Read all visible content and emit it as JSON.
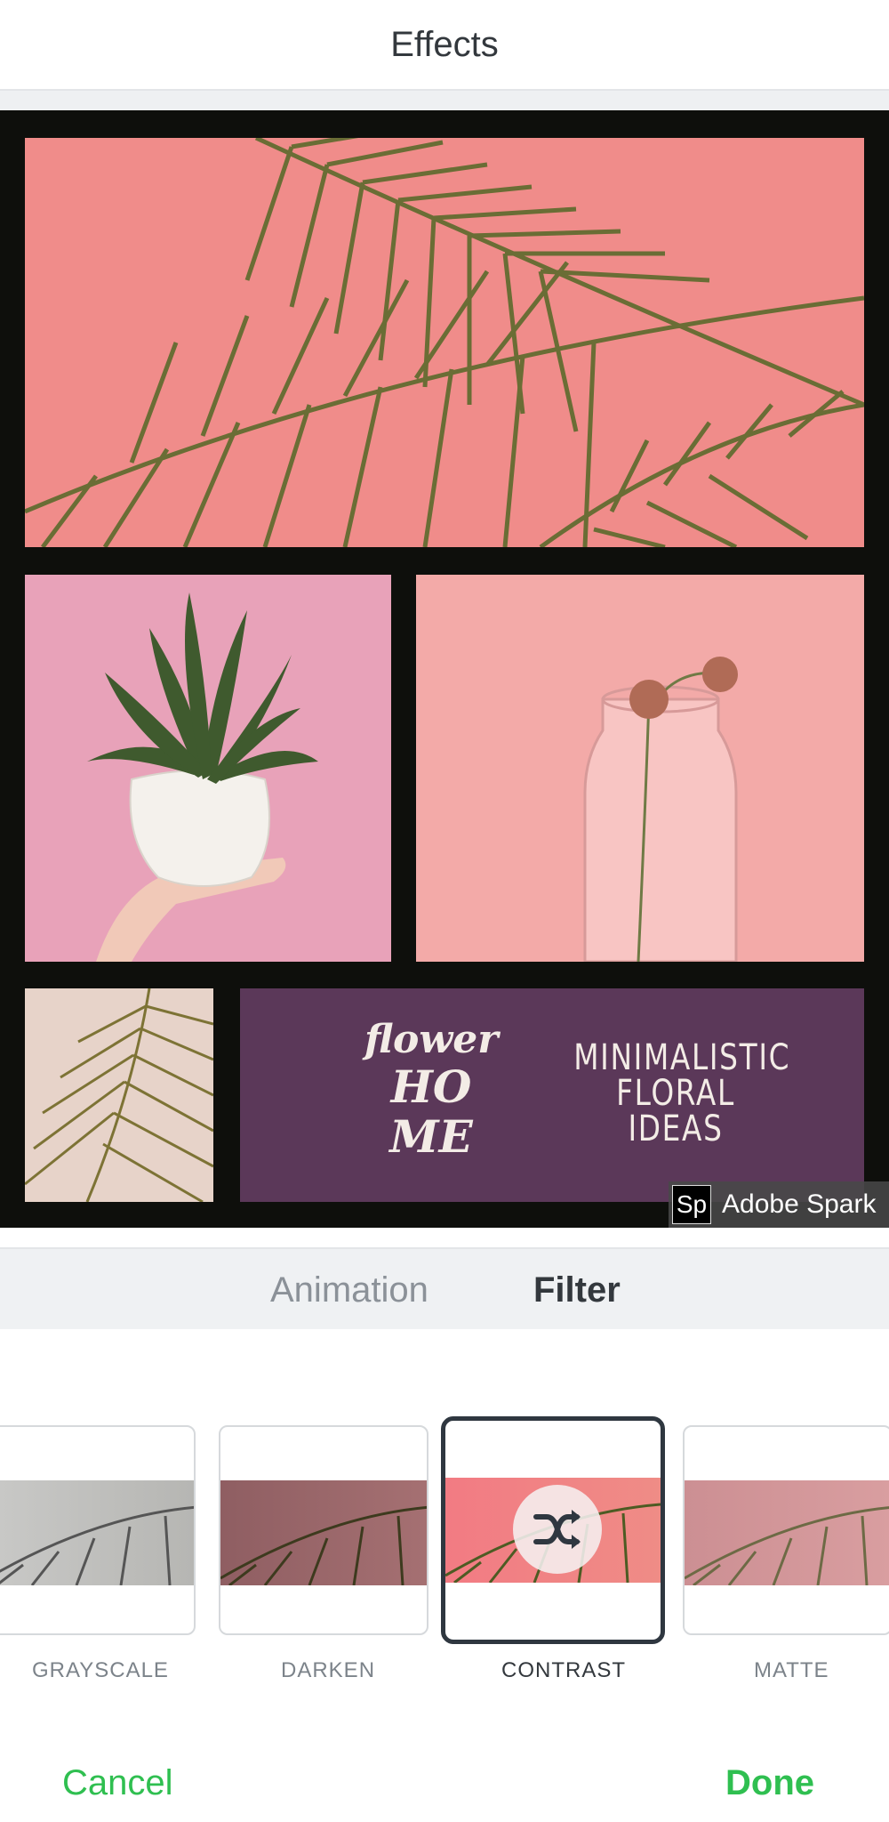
{
  "header": {
    "title": "Effects"
  },
  "canvas": {
    "promo": {
      "script_lines": [
        "flower",
        "HO",
        "ME"
      ],
      "headline": "MINIMALISTIC FLORAL IDEAS"
    },
    "badge": {
      "logo": "Sp",
      "text": "Adobe Spark"
    }
  },
  "tabs": [
    {
      "label": "Animation",
      "active": false
    },
    {
      "label": "Filter",
      "active": true
    }
  ],
  "filters": [
    {
      "label": "GRAYSCALE",
      "selected": false
    },
    {
      "label": "DARKEN",
      "selected": false
    },
    {
      "label": "CONTRAST",
      "selected": true,
      "icon": "shuffle-icon"
    },
    {
      "label": "MATTE",
      "selected": false
    }
  ],
  "footer": {
    "cancel": "Cancel",
    "done": "Done"
  },
  "colors": {
    "accent_green": "#2fbf50",
    "text_dark": "#33383d",
    "promo_bg": "#5b3859"
  }
}
